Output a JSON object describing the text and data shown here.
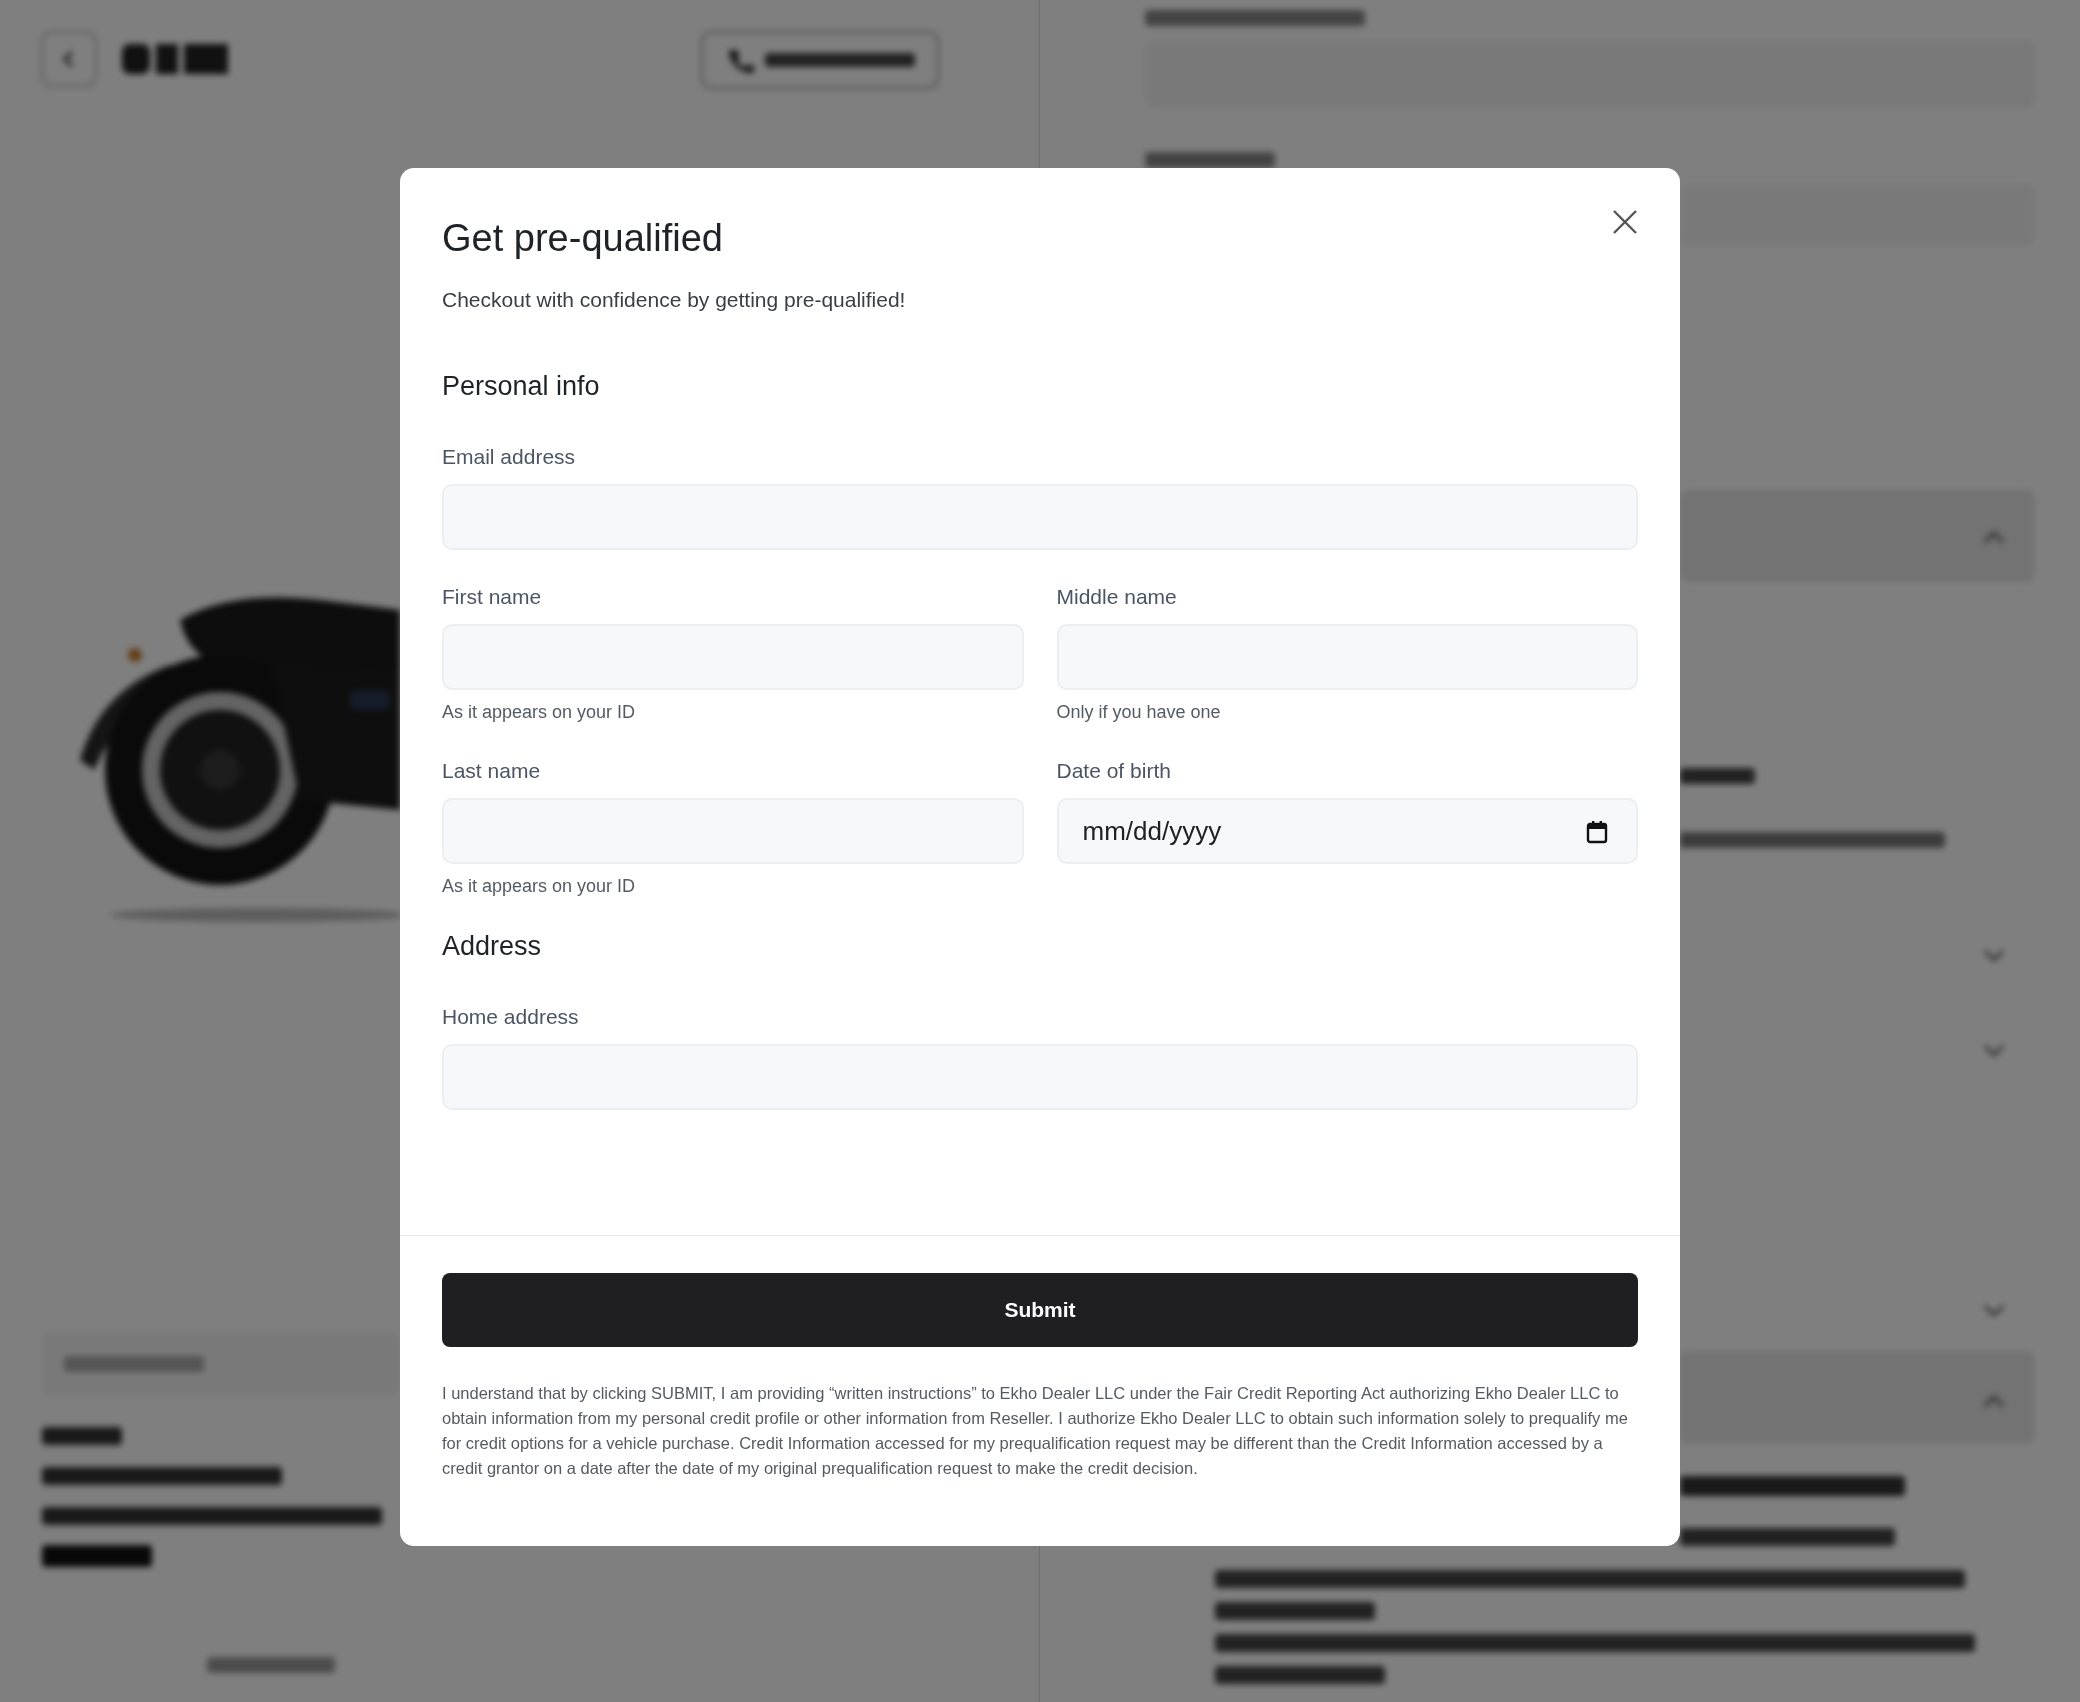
{
  "dialog": {
    "title": "Get pre-qualified",
    "subtitle": "Checkout with confidence by getting pre-qualified!",
    "sections": [
      {
        "heading": "Personal info",
        "rows": [
          [
            {
              "label": "Email address",
              "kind": "text"
            }
          ],
          [
            {
              "label": "First name",
              "kind": "text",
              "hint": "As it appears on your ID"
            },
            {
              "label": "Middle name",
              "kind": "text",
              "hint": "Only if you have one"
            }
          ],
          [
            {
              "label": "Last name",
              "kind": "text",
              "hint": "As it appears on your ID"
            },
            {
              "label": "Date of birth",
              "kind": "date",
              "placeholder": "mm/dd/yyyy"
            }
          ]
        ]
      },
      {
        "heading": "Address",
        "rows": [
          [
            {
              "label": "Home address",
              "kind": "text"
            }
          ]
        ]
      }
    ],
    "submit": "Submit",
    "legal": "I understand that by clicking SUBMIT, I am providing “written instructions” to Ekho Dealer LLC under the Fair Credit Reporting Act authorizing Ekho Dealer LLC to obtain information from my personal credit profile or other information from Reseller. I authorize Ekho Dealer LLC to obtain such information solely to prequalify me for credit options for a vehicle purchase. Credit Information accessed for my prequalification request may be different than the Credit Information accessed by a credit grantor on a date after the date of my original prequalification request to make the credit decision."
  }
}
